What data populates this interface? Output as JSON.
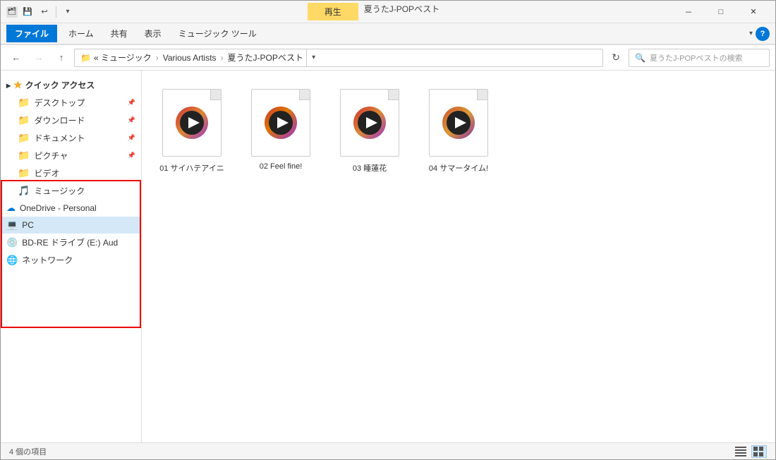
{
  "window": {
    "title": "夏うたJ-POPベスト",
    "title_tab": "再生"
  },
  "titlebar": {
    "quick_access_icons": [
      "📁",
      "⎘",
      "↩"
    ],
    "app_icon": "🗂",
    "minimize_label": "－",
    "maximize_label": "□",
    "close_label": "✕"
  },
  "ribbon": {
    "tabs": [
      {
        "label": "ファイル",
        "active": true
      },
      {
        "label": "ホーム",
        "active": false
      },
      {
        "label": "共有",
        "active": false
      },
      {
        "label": "表示",
        "active": false
      },
      {
        "label": "ミュージック ツール",
        "active": false
      }
    ]
  },
  "addressbar": {
    "back_label": "←",
    "forward_label": "→",
    "up_label": "↑",
    "path": [
      "« ミュージック",
      "Various Artists",
      "夏うたJ-POPベスト"
    ],
    "search_placeholder": "夏うたJ-POPベストの検索"
  },
  "sidebar": {
    "quick_access_label": "クイック アクセス",
    "items": [
      {
        "label": "デスクトップ",
        "type": "folder_yellow",
        "pinned": true
      },
      {
        "label": "ダウンロード",
        "type": "folder_yellow",
        "pinned": true
      },
      {
        "label": "ドキュメント",
        "type": "folder_blue",
        "pinned": true
      },
      {
        "label": "ピクチャ",
        "type": "folder_blue",
        "pinned": true
      },
      {
        "label": "ビデオ",
        "type": "folder_blue",
        "pinned": false
      },
      {
        "label": "ミュージック",
        "type": "folder_yellow",
        "pinned": false
      },
      {
        "label": "OneDrive - Personal",
        "type": "cloud",
        "pinned": false
      },
      {
        "label": "PC",
        "type": "pc",
        "selected": true
      },
      {
        "label": "BD-RE ドライブ (E:) Aud",
        "type": "disc"
      },
      {
        "label": "ネットワーク",
        "type": "network"
      }
    ]
  },
  "files": [
    {
      "name": "01 サイハテアイニ",
      "index": 1
    },
    {
      "name": "02 Feel fine!",
      "index": 2
    },
    {
      "name": "03 睡蓮花",
      "index": 3
    },
    {
      "name": "04 サマータイム!",
      "index": 4
    }
  ],
  "statusbar": {
    "count_label": "4 個の項目",
    "view_list_label": "≡",
    "view_large_label": "⊞"
  },
  "colors": {
    "accent": "#0078d7",
    "folder_yellow": "#d4a017",
    "selection_blue": "#d4e8f7",
    "tab_yellow": "#ffd966",
    "media_gradient_start": "#e05050",
    "media_gradient_end": "#9050c0"
  }
}
